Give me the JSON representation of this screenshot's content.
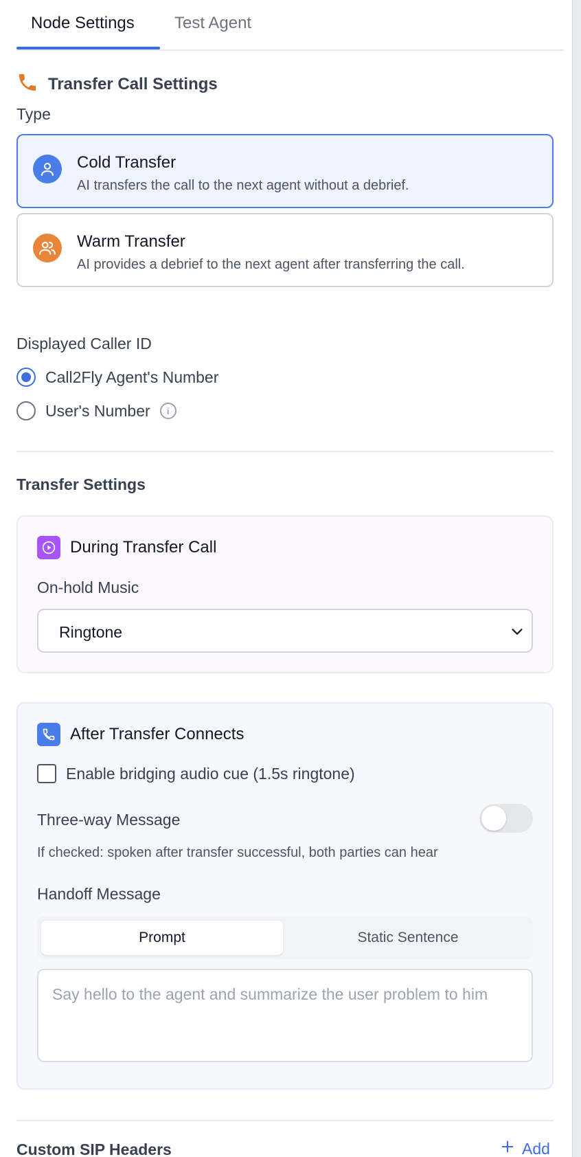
{
  "tabs": [
    {
      "label": "Node Settings",
      "active": true
    },
    {
      "label": "Test Agent",
      "active": false
    }
  ],
  "section": {
    "title": "Transfer Call Settings",
    "icon": "phone-icon",
    "icon_color": "#e07a2c"
  },
  "type": {
    "label": "Type",
    "options": [
      {
        "name": "Cold Transfer",
        "description": "AI transfers the call to the next agent without a debrief.",
        "selected": true,
        "icon": "user-icon",
        "icon_color": "#4a7de8"
      },
      {
        "name": "Warm Transfer",
        "description": "AI provides a debrief to the next agent after transferring the call.",
        "selected": false,
        "icon": "users-icon",
        "icon_color": "#e98539"
      }
    ]
  },
  "caller_id": {
    "label": "Displayed Caller ID",
    "options": [
      {
        "label": "Call2Fly Agent's Number",
        "selected": true
      },
      {
        "label": "User's Number",
        "selected": false
      }
    ]
  },
  "transfer_settings": {
    "heading": "Transfer Settings",
    "during": {
      "title": "During Transfer Call",
      "icon": "play-circle-icon",
      "icon_color": "#a855f7",
      "music_label": "On-hold Music",
      "music_value": "Ringtone"
    },
    "after": {
      "title": "After Transfer Connects",
      "icon": "phone-icon",
      "icon_color": "#4a7de8",
      "bridging_label": "Enable bridging audio cue (1.5s ringtone)",
      "bridging_checked": false,
      "three_way_label": "Three-way Message",
      "three_way_enabled": false,
      "three_way_help": "If checked: spoken after transfer successful, both parties can hear",
      "handoff_label": "Handoff Message",
      "handoff_tabs": [
        "Prompt",
        "Static Sentence"
      ],
      "handoff_active": "Prompt",
      "handoff_placeholder": "Say hello to the agent and summarize the user problem to him"
    }
  },
  "sip": {
    "title": "Custom SIP Headers",
    "add_label": "Add"
  }
}
